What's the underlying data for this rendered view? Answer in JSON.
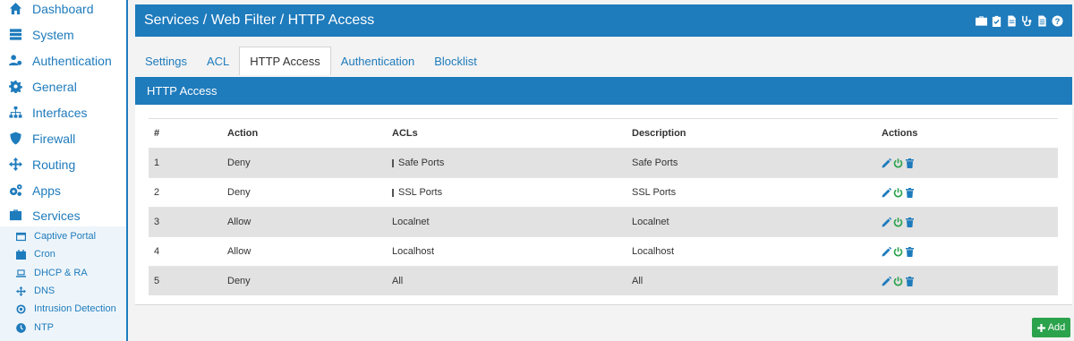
{
  "sidebar": {
    "items": [
      {
        "label": "Dashboard",
        "icon": "home-icon"
      },
      {
        "label": "System",
        "icon": "server-icon"
      },
      {
        "label": "Authentication",
        "icon": "user-gear-icon"
      },
      {
        "label": "General",
        "icon": "cog-icon"
      },
      {
        "label": "Interfaces",
        "icon": "sitemap-icon"
      },
      {
        "label": "Firewall",
        "icon": "shield-icon"
      },
      {
        "label": "Routing",
        "icon": "arrows-icon"
      },
      {
        "label": "Apps",
        "icon": "cogs-icon"
      },
      {
        "label": "Services",
        "icon": "briefcase-icon"
      }
    ],
    "subitems": [
      {
        "label": "Captive Portal",
        "icon": "window-icon"
      },
      {
        "label": "Cron",
        "icon": "calendar-icon"
      },
      {
        "label": "DHCP & RA",
        "icon": "laptop-icon"
      },
      {
        "label": "DNS",
        "icon": "arrows-icon"
      },
      {
        "label": "Intrusion Detection",
        "icon": "target-icon"
      },
      {
        "label": "NTP",
        "icon": "clock-icon"
      }
    ]
  },
  "header": {
    "title": "Services / Web Filter / HTTP Access",
    "tool_icons": [
      "toolbox-icon",
      "clipboard-check-icon",
      "file-icon",
      "stethoscope-icon",
      "file-text-icon",
      "question-icon"
    ]
  },
  "tabs": [
    "Settings",
    "ACL",
    "HTTP Access",
    "Authentication",
    "Blocklist"
  ],
  "active_tab": "HTTP Access",
  "section": {
    "title": "HTTP Access"
  },
  "table": {
    "columns": [
      "#",
      "Action",
      "ACLs",
      "Description",
      "Actions"
    ],
    "rows": [
      {
        "num": "1",
        "action": "Deny",
        "acls": "Safe Ports",
        "acl_negated": true,
        "description": "Safe Ports"
      },
      {
        "num": "2",
        "action": "Deny",
        "acls": "SSL Ports",
        "acl_negated": true,
        "description": "SSL Ports"
      },
      {
        "num": "3",
        "action": "Allow",
        "acls": "Localnet",
        "acl_negated": false,
        "description": "Localnet"
      },
      {
        "num": "4",
        "action": "Allow",
        "acls": "Localhost",
        "acl_negated": false,
        "description": "Localhost"
      },
      {
        "num": "5",
        "action": "Deny",
        "acls": "All",
        "acl_negated": false,
        "description": "All"
      }
    ]
  },
  "add_button": {
    "label": "Add"
  },
  "colors": {
    "brand": "#1e7bbc",
    "success": "#2ba24c",
    "edit": "#1e7bbc",
    "toggle": "#2ba24c",
    "delete": "#1e7bbc"
  }
}
